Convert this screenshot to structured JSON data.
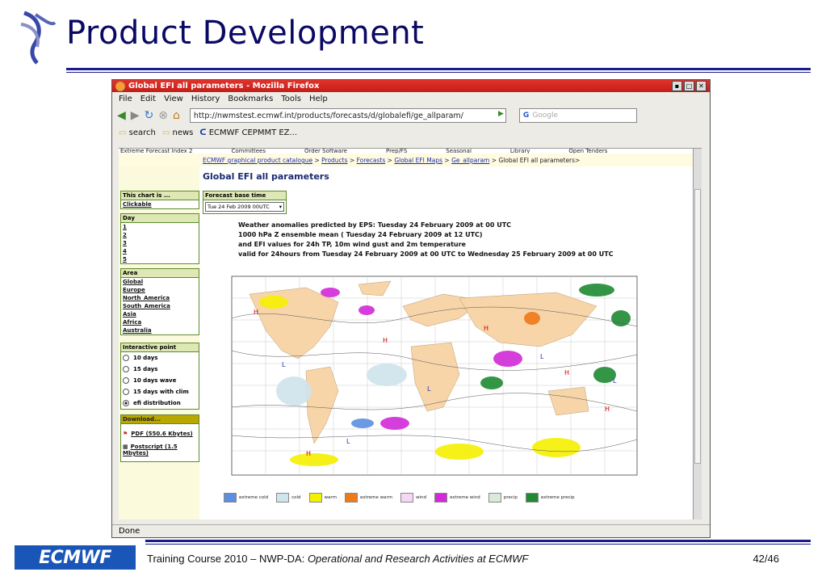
{
  "slide": {
    "title": "Product Development",
    "footer_logo": "ECMWF",
    "footer_text": "Training Course 2010 – NWP-DA: ",
    "footer_italic": "Operational and Research Activities at ECMWF",
    "page_number": "42/46"
  },
  "browser": {
    "window_title": "Global EFI all parameters - Mozilla Firefox",
    "menu": [
      "File",
      "Edit",
      "View",
      "History",
      "Bookmarks",
      "Tools",
      "Help"
    ],
    "url": "http://nwmstest.ecmwf.int/products/forecasts/d/globalefi/ge_allparam/",
    "search_placeholder": "Google",
    "bookmarks": [
      "search",
      "news",
      "ECMWF CEPMMT EZ..."
    ],
    "status": "Done"
  },
  "page": {
    "top_nav": [
      "Extreme Forecast Index 2",
      "Committees",
      "Order Software",
      "Prep/FS",
      "Seasonal",
      "Library",
      "Open Tenders"
    ],
    "breadcrumb": [
      "ECMWF graphical product catalogue",
      "Products",
      "Forecasts",
      "Global EFI Maps",
      "Ge_allparam"
    ],
    "breadcrumb_tail": "Global EFI all parameters>",
    "heading": "Global EFI all parameters",
    "this_chart": {
      "header": "This chart is ...",
      "item": "Clickable"
    },
    "day": {
      "header": "Day",
      "items": [
        "1",
        "2",
        "3",
        "4",
        "5"
      ]
    },
    "area": {
      "header": "Area",
      "items": [
        "Global",
        "Europe",
        "North_America",
        "South_America",
        "Asia",
        "Africa",
        "Australia"
      ],
      "selected": "Global"
    },
    "interactive": {
      "header": "Interactive point",
      "items": [
        "10 days",
        "15 days",
        "10 days wave",
        "15 days with clim",
        "efi distribution"
      ],
      "selected": "efi distribution"
    },
    "download": {
      "header": "Download...",
      "pdf": "PDF (550.6 Kbytes)",
      "ps": "Postscript (1.5 Mbytes)"
    },
    "forecast_base": {
      "header": "Forecast base time",
      "value": "Tue 24 Feb 2009 00UTC"
    },
    "caption": [
      "Weather anomalies predicted by EPS: Tuesday 24 February 2009 at 00 UTC",
      "1000 hPa Z ensemble mean ( Tuesday 24 February 2009 at 12 UTC)",
      "and EFI values for 24h TP, 10m wind gust and 2m temperature",
      "valid for 24hours from  Tuesday 24 February 2009 at 00 UTC to  Wednesday 25 February 2009 at 00 UTC"
    ],
    "legend": [
      {
        "label": "extreme cold",
        "color": "#5d8ee0"
      },
      {
        "label": "cold",
        "color": "#cfe4ec"
      },
      {
        "label": "warm",
        "color": "#f5f000"
      },
      {
        "label": "extreme warm",
        "color": "#ef7a1a"
      },
      {
        "label": "wind",
        "color": "#f6d8f6"
      },
      {
        "label": "extreme wind",
        "color": "#d22ad8"
      },
      {
        "label": "precip",
        "color": "#d7ecd7"
      },
      {
        "label": "extreme precip",
        "color": "#1f8a33"
      }
    ]
  }
}
